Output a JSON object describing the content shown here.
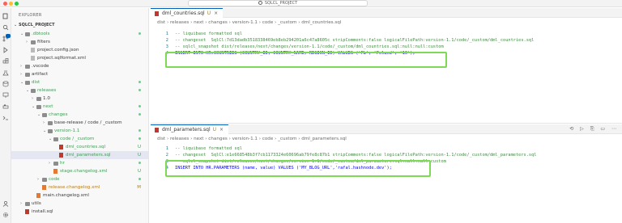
{
  "window": {
    "title": "SQLCL_PROJECT"
  },
  "explorer": {
    "title": "EXPLORER",
    "project": "SQLCL_PROJECT",
    "tree": [
      {
        "label": ".dbtools",
        "kind": "folder",
        "depth": 1,
        "expanded": true,
        "status": "dot"
      },
      {
        "label": "filters",
        "kind": "folder",
        "depth": 2,
        "expanded": false,
        "status": ""
      },
      {
        "label": "project.config.json",
        "kind": "file",
        "depth": 2,
        "status": ""
      },
      {
        "label": "project.sqlformat.xml",
        "kind": "file",
        "depth": 2,
        "status": ""
      },
      {
        "label": ".vscode",
        "kind": "folder",
        "depth": 1,
        "expanded": false,
        "status": ""
      },
      {
        "label": "artifact",
        "kind": "folder",
        "depth": 1,
        "expanded": false,
        "status": ""
      },
      {
        "label": "dist",
        "kind": "folder",
        "depth": 1,
        "expanded": true,
        "status": "dot"
      },
      {
        "label": "releases",
        "kind": "folder",
        "depth": 2,
        "expanded": true,
        "status": "dot"
      },
      {
        "label": "1.0",
        "kind": "folder",
        "depth": 3,
        "expanded": false,
        "status": ""
      },
      {
        "label": "next",
        "kind": "folder",
        "depth": 3,
        "expanded": true,
        "status": "dot"
      },
      {
        "label": "changes",
        "kind": "folder",
        "depth": 4,
        "expanded": true,
        "status": "dot"
      },
      {
        "label": "base-release / code / _custom",
        "kind": "folder",
        "depth": 5,
        "expanded": false,
        "status": ""
      },
      {
        "label": "version-1.1",
        "kind": "folder",
        "depth": 5,
        "expanded": true,
        "status": "dot"
      },
      {
        "label": "code / _custom",
        "kind": "folder",
        "depth": 6,
        "expanded": true,
        "status": "dot"
      },
      {
        "label": "dml_countries.sql",
        "kind": "sql",
        "depth": 7,
        "status": "U"
      },
      {
        "label": "dml_parameters.sql",
        "kind": "sql",
        "depth": 7,
        "status": "U",
        "selected": true
      },
      {
        "label": "hr",
        "kind": "folder",
        "depth": 6,
        "expanded": false,
        "status": "dot"
      },
      {
        "label": "stage.changelog.xml",
        "kind": "xml",
        "depth": 6,
        "status": "U"
      },
      {
        "label": "code",
        "kind": "folder",
        "depth": 4,
        "expanded": false,
        "status": "dot"
      },
      {
        "label": "release.changelog.xml",
        "kind": "xml",
        "depth": 4,
        "status": "M"
      },
      {
        "label": "main.changelog.xml",
        "kind": "xml",
        "depth": 3,
        "status": ""
      },
      {
        "label": "utils",
        "kind": "folder",
        "depth": 1,
        "expanded": false,
        "status": ""
      },
      {
        "label": "install.sql",
        "kind": "sql",
        "depth": 1,
        "status": ""
      }
    ]
  },
  "editor_top": {
    "tab_label": "dml_countries.sql",
    "tab_status": "U",
    "breadcrumb": "dist › releases › next › changes › version-1.1 › code › _custom › dml_countries.sql",
    "lines": [
      {
        "n": "1",
        "text": "-- liquibase formatted sql"
      },
      {
        "n": "2",
        "text": "-- changeset  SqlCl:7d13dadb3518338469eb8eb294201a6c47a8605c stripComments:false logicalFilePath:version-1.1/code/_custom/dml_countries.sql"
      },
      {
        "n": "3",
        "text": "-- sqlcl_snapshot dist/releases/next/changes/version-1.1/code/_custom/dml_countries.sql:null:null:custom"
      },
      {
        "n": "4",
        "text": "INSERT INTO HR.COUNTRIES (COUNTRY_ID, COUNTRY_NAME, REGION_ID) VALUES ('PL', 'Poland', '10');"
      }
    ]
  },
  "editor_bottom": {
    "tab_label": "dml_parameters.sql",
    "tab_status": "U",
    "breadcrumb": "dist › releases › next › changes › version-1.1 › code › _custom › dml_parameters.sql",
    "lines": [
      {
        "n": "1",
        "text": "-- liquibase formatted sql"
      },
      {
        "n": "2",
        "text": "-- changeset  SqlCl:e1e668548b3f7cb1173324e60696ab79fe8c87b1 stripComments:false logicalFilePath:version-1.1/code/_custom/dml_parameters.sql"
      },
      {
        "n": "3",
        "text": "-- sqlcl_snapshot dist/releases/next/changes/version-1.1/code/_custom/dml_parameters.sql:null:null:custom"
      },
      {
        "n": "4",
        "text": "INSERT INTO HR.PARAMETERS (name, value) VALUES ('MY_BLOG_URL','rafal.hashnode.dev');"
      }
    ],
    "actions": "⟲ ▷ ⎘ ▭ ⋯"
  },
  "colors": {
    "highlight": "#7ed957",
    "untracked": "#3f9c56",
    "modified": "#b77c17",
    "accent": "#005fb8"
  },
  "icons": [
    "files-icon",
    "search-icon",
    "source-control-icon",
    "run-debug-icon",
    "extensions-icon",
    "database-icon",
    "account-icon",
    "settings-icon",
    "folder-icon",
    "sql-file-icon",
    "xml-file-icon",
    "chevron-down-icon",
    "chevron-right-icon"
  ]
}
